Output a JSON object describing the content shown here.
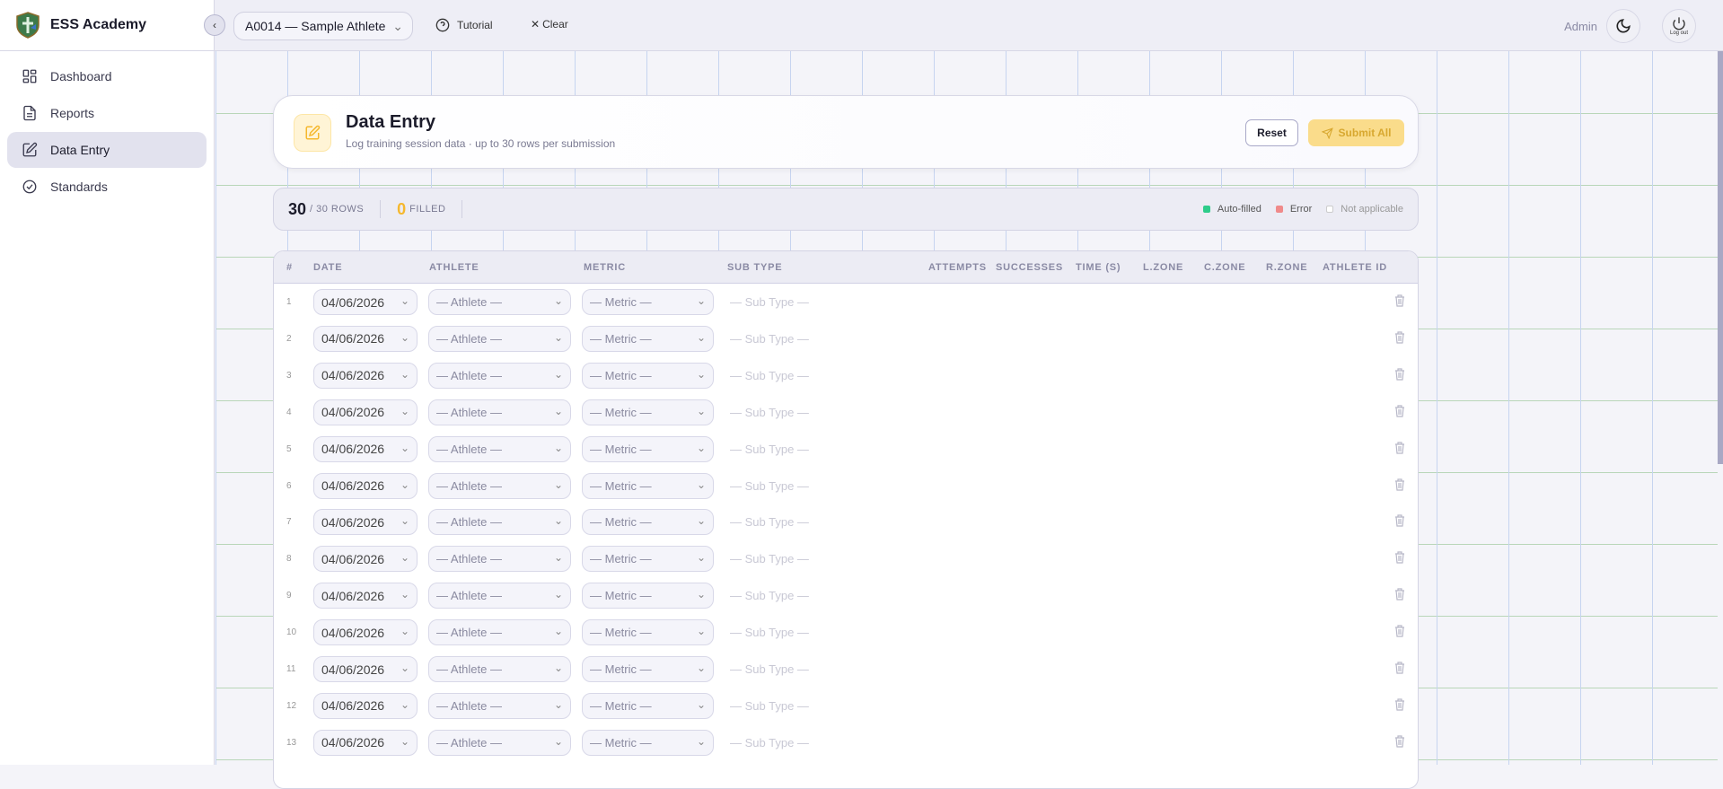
{
  "brand": {
    "name": "ESS Academy"
  },
  "sidebar": {
    "items": [
      {
        "label": "Dashboard",
        "icon": "grid-icon"
      },
      {
        "label": "Reports",
        "icon": "document-icon"
      },
      {
        "label": "Data Entry",
        "icon": "edit-icon",
        "active": true
      },
      {
        "label": "Standards",
        "icon": "check-badge-icon"
      }
    ]
  },
  "topbar": {
    "athlete_select": "A0014 — Sample Athlete",
    "tutorial": "Tutorial",
    "clear": "Clear",
    "user": "Admin",
    "logout": "Log out"
  },
  "page": {
    "title": "Data Entry",
    "subtitle": "Log training session data · up to 30 rows per submission",
    "reset": "Reset",
    "submit": "Submit All"
  },
  "stats": {
    "rows": "30",
    "rows_label": "/ 30 ROWS",
    "filled": "0",
    "filled_label": "FILLED"
  },
  "legend": [
    {
      "label": "Auto-filled",
      "color": "#2ecc8a"
    },
    {
      "label": "Error",
      "color": "#f08a8a"
    },
    {
      "label": "Not applicable",
      "color": "#ffffff"
    }
  ],
  "colors": {
    "accent": "#f5b82e",
    "submit_bg": "#fadc8b"
  },
  "table": {
    "headers": [
      "#",
      "DATE",
      "ATHLETE",
      "METRIC",
      "SUB TYPE",
      "ATTEMPTS",
      "SUCCESSES",
      "TIME (S)",
      "L.ZONE",
      "C.ZONE",
      "R.ZONE",
      "ATHLETE ID"
    ],
    "rows": [
      {
        "n": "1",
        "date": "04/06/2026",
        "athlete": "— Athlete —",
        "metric": "— Metric —",
        "subtype": "— Sub Type —"
      },
      {
        "n": "2",
        "date": "04/06/2026",
        "athlete": "— Athlete —",
        "metric": "— Metric —",
        "subtype": "— Sub Type —"
      },
      {
        "n": "3",
        "date": "04/06/2026",
        "athlete": "— Athlete —",
        "metric": "— Metric —",
        "subtype": "— Sub Type —"
      },
      {
        "n": "4",
        "date": "04/06/2026",
        "athlete": "— Athlete —",
        "metric": "— Metric —",
        "subtype": "— Sub Type —"
      },
      {
        "n": "5",
        "date": "04/06/2026",
        "athlete": "— Athlete —",
        "metric": "— Metric —",
        "subtype": "— Sub Type —"
      },
      {
        "n": "6",
        "date": "04/06/2026",
        "athlete": "— Athlete —",
        "metric": "— Metric —",
        "subtype": "— Sub Type —"
      },
      {
        "n": "7",
        "date": "04/06/2026",
        "athlete": "— Athlete —",
        "metric": "— Metric —",
        "subtype": "— Sub Type —"
      },
      {
        "n": "8",
        "date": "04/06/2026",
        "athlete": "— Athlete —",
        "metric": "— Metric —",
        "subtype": "— Sub Type —"
      },
      {
        "n": "9",
        "date": "04/06/2026",
        "athlete": "— Athlete —",
        "metric": "— Metric —",
        "subtype": "— Sub Type —"
      },
      {
        "n": "10",
        "date": "04/06/2026",
        "athlete": "— Athlete —",
        "metric": "— Metric —",
        "subtype": "— Sub Type —"
      },
      {
        "n": "11",
        "date": "04/06/2026",
        "athlete": "— Athlete —",
        "metric": "— Metric —",
        "subtype": "— Sub Type —"
      },
      {
        "n": "12",
        "date": "04/06/2026",
        "athlete": "— Athlete —",
        "metric": "— Metric —",
        "subtype": "— Sub Type —"
      },
      {
        "n": "13",
        "date": "04/06/2026",
        "athlete": "— Athlete —",
        "metric": "— Metric —",
        "subtype": "— Sub Type —"
      }
    ]
  }
}
